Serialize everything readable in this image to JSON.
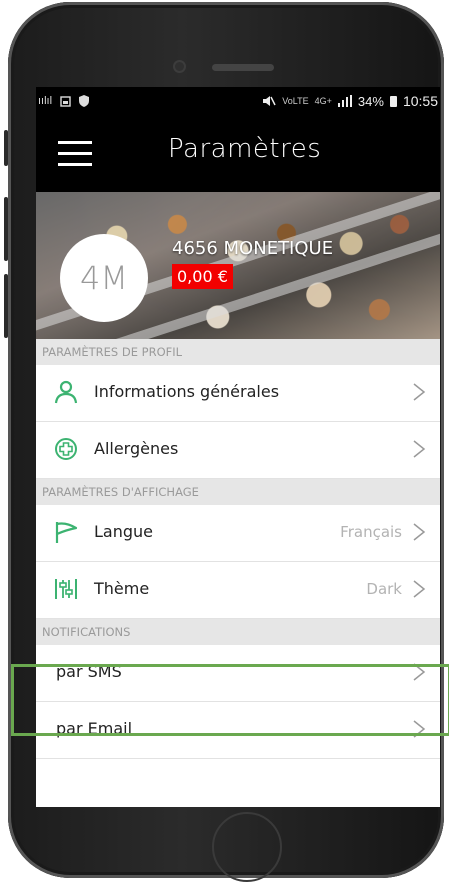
{
  "status_bar": {
    "left_text": "ıılıl",
    "signal_small": "VoLTE",
    "network": "4G+",
    "battery": "34%",
    "time": "10:55"
  },
  "app_bar": {
    "title": "Paramètres"
  },
  "profile": {
    "avatar_initials": "4M",
    "account_name": "4656 MONETIQUE",
    "balance": "0,00 €"
  },
  "sections": {
    "profile_header": "PARAMÈTRES DE PROFIL",
    "display_header": "PARAMÈTRES D'AFFICHAGE",
    "notifications_header": "NOTIFICATIONS"
  },
  "rows": {
    "general_info": {
      "label": "Informations générales",
      "icon": "person-icon"
    },
    "allergens": {
      "label": "Allergènes",
      "icon": "plus-circle-icon"
    },
    "language": {
      "label": "Langue",
      "value": "Français",
      "icon": "flag-icon"
    },
    "theme": {
      "label": "Thème",
      "value": "Dark",
      "icon": "sliders-icon"
    },
    "sms": {
      "label": "par SMS"
    },
    "email": {
      "label": "par Email"
    }
  },
  "colors": {
    "accent_green": "#3cb371",
    "balance_red": "#f20000",
    "highlight_green": "#6aa84f"
  }
}
